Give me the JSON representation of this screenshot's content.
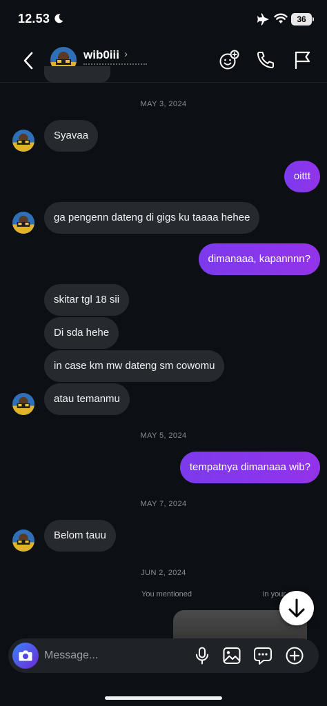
{
  "status_bar": {
    "time": "12.53",
    "battery": "36"
  },
  "header": {
    "username": "wib0iii",
    "chevron": "›"
  },
  "dates": [
    "MAY 3, 2024",
    "MAY 5, 2024",
    "MAY 7, 2024",
    "JUN 2, 2024"
  ],
  "messages": [
    {
      "side": "in",
      "text": "Syavaa"
    },
    {
      "side": "out",
      "text": "oittt"
    },
    {
      "side": "in",
      "text": "ga pengenn dateng di gigs ku taaaa hehee"
    },
    {
      "side": "out",
      "text": "dimanaaa, kapannnn?"
    },
    {
      "side": "in",
      "text": "skitar tgl 18 sii"
    },
    {
      "side": "in",
      "text": "Di sda hehe"
    },
    {
      "side": "in",
      "text": "in case km mw dateng sm cowomu"
    },
    {
      "side": "in",
      "text": "atau temanmu"
    },
    {
      "side": "out",
      "text": "tempatnya dimanaaa wib?"
    },
    {
      "side": "in",
      "text": "Belom tauu"
    }
  ],
  "mention": {
    "left": "You mentioned",
    "right": "in your story"
  },
  "composer": {
    "placeholder": "Message..."
  },
  "colors": {
    "background": "#0c1014",
    "incoming_bubble": "#262a2f",
    "outgoing_bubble": "#8b2fe6",
    "camera_button": "#4f46e5"
  },
  "icons": [
    "moon-icon",
    "airplane-icon",
    "wifi-icon",
    "back-icon",
    "sticker-icon",
    "phone-icon",
    "flag-icon",
    "camera-icon",
    "microphone-icon",
    "image-icon",
    "chat-bubble-icon",
    "plus-icon",
    "arrow-down-icon"
  ]
}
